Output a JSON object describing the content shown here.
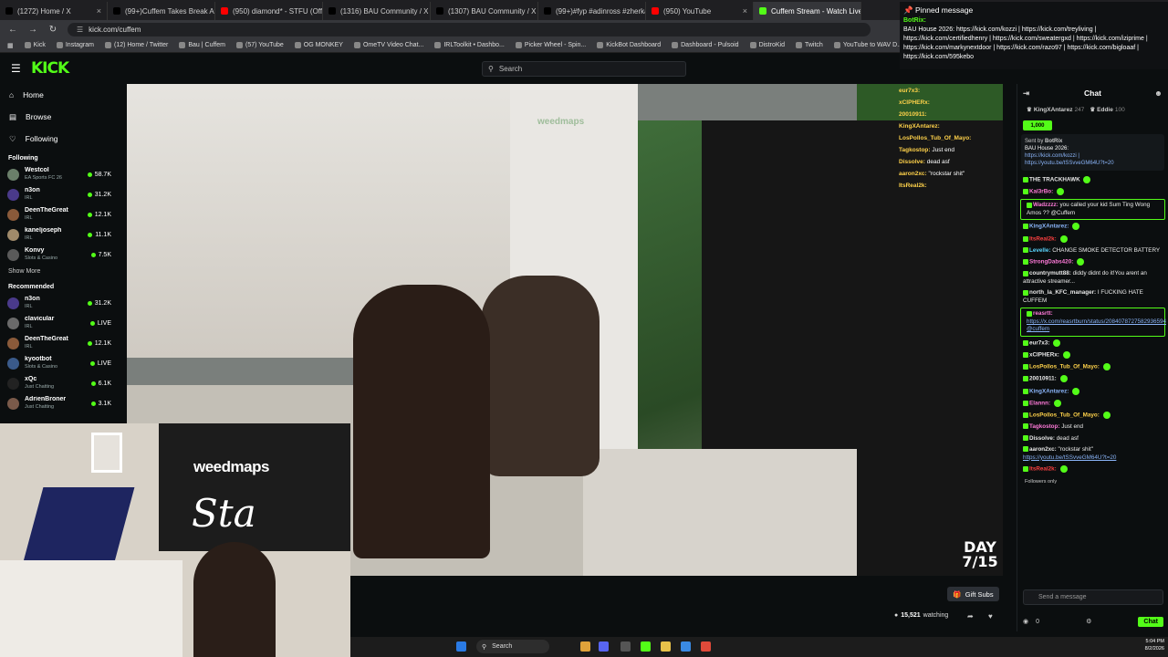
{
  "browser": {
    "tabs": [
      {
        "title": "(1272) Home / X",
        "color": "#000000"
      },
      {
        "title": "(99+)Cuffem Takes Break After",
        "color": "#000000"
      },
      {
        "title": "(950) diamond* - STFU (Official",
        "color": "#ff0000"
      },
      {
        "title": "(1316) BAU Community / X",
        "color": "#000000"
      },
      {
        "title": "(1307) BAU Community / X",
        "color": "#000000"
      },
      {
        "title": "(99+)#fyp #adinross #zherka #",
        "color": "#000000"
      },
      {
        "title": "(950) YouTube",
        "color": "#ff0000"
      },
      {
        "title": "Cuffem Stream - Watch Live on",
        "color": "#53fc18"
      }
    ],
    "url": "kick.com/cuffem",
    "bookmarks": [
      "Kick",
      "Instagram",
      "(12) Home / Twitter",
      "Bau | Cuffem",
      "(57) YouTube",
      "OG MONKEY",
      "OmeTV Video Chat...",
      "IRLToolkit • Dashbo...",
      "Picker Wheel - Spin...",
      "KickBot Dashboard",
      "Dashboard - Pulsoid",
      "DistroKid",
      "Twitch",
      "YouTube to WAV D...",
      "Monkey: Video Chat...",
      "Home - Rob"
    ]
  },
  "header": {
    "logo": "KICK",
    "search_placeholder": "Search"
  },
  "sidebar": {
    "nav": [
      {
        "label": "Home",
        "icon": "home-icon"
      },
      {
        "label": "Browse",
        "icon": "browse-icon"
      },
      {
        "label": "Following",
        "icon": "heart-icon"
      }
    ],
    "following_title": "Following",
    "following": [
      {
        "name": "Westcol",
        "category": "EA Sports FC 26",
        "viewers": "58.7K",
        "color": "#6a7f6a"
      },
      {
        "name": "n3on",
        "category": "IRL",
        "viewers": "31.2K",
        "color": "#4a3a8a"
      },
      {
        "name": "DeenTheGreat",
        "category": "IRL",
        "viewers": "12.1K",
        "color": "#8a5a3a"
      },
      {
        "name": "kaneljoseph",
        "category": "IRL",
        "viewers": "11.1K",
        "color": "#a08a6a"
      },
      {
        "name": "Konvy",
        "category": "Slots & Casino",
        "viewers": "7.5K",
        "color": "#5a5a5a"
      }
    ],
    "show_more": "Show More",
    "recommended_title": "Recommended",
    "recommended": [
      {
        "name": "n3on",
        "category": "IRL",
        "viewers": "31.2K",
        "color": "#4a3a8a"
      },
      {
        "name": "clavicular",
        "category": "IRL",
        "viewers": "LIVE",
        "color": "#6a6a6a"
      },
      {
        "name": "DeenTheGreat",
        "category": "IRL",
        "viewers": "12.1K",
        "color": "#8a5a3a"
      },
      {
        "name": "kyootbot",
        "category": "Slots & Casino",
        "viewers": "LIVE",
        "color": "#3a5a8a"
      },
      {
        "name": "xQc",
        "category": "Just Chatting",
        "viewers": "6.1K",
        "color": "#222222"
      },
      {
        "name": "AdrienBroner",
        "category": "Just Chatting",
        "viewers": "3.1K",
        "color": "#7a5a4a"
      }
    ]
  },
  "video": {
    "day_line1": "DAY",
    "day_line2": "7/15",
    "webcam_banner": "weedmaps",
    "webcam_sign": "Sta",
    "room_brand": "weedmaps",
    "overlay_chat": [
      {
        "user": "eur7x3:",
        "text": ""
      },
      {
        "user": "xCIPHERx:",
        "text": ""
      },
      {
        "user": "20010911:",
        "text": ""
      },
      {
        "user": "KingXAntarez:",
        "text": ""
      },
      {
        "user": "LosPollos_Tub_Of_Mayo:",
        "text": ""
      },
      {
        "user": "Tagkostop:",
        "text": "Just end"
      },
      {
        "user": "Dissolve:",
        "text": "dead asf"
      },
      {
        "user": "aaron2xc:",
        "text": "\"rockstar shit\""
      },
      {
        "user": "ItsReal2k:",
        "text": ""
      }
    ]
  },
  "below_video": {
    "gift_subs": "Gift Subs",
    "watching_count": "15,521",
    "watching_label": "watching"
  },
  "pinned": {
    "title": "Pinned message",
    "author": "BotRix:",
    "text": "BAU House 2026: https://kick.com/kozzi | https://kick.com/treyliving | https://kick.com/certifiedhenry | https://kick.com/sweatergxd | https://kick.com/iziprime | https://kick.com/markynextdoor | https://kick.com/razo97 | https://kick.com/bigloaaf | https://kick.com/595kebo"
  },
  "chat": {
    "title": "Chat",
    "gifters": [
      {
        "name": "KingXAntarez",
        "count": "247"
      },
      {
        "name": "Eddie",
        "count": "100"
      }
    ],
    "goal": "1,000",
    "pin_sent_by": "Sent by",
    "pin_author": "BotRix",
    "pin_text": "BAU House 2026:",
    "pin_link": "https://kick.com/kozzi |",
    "pin_extra": "https://youtu.be/tSSvveGM64U?t=20",
    "messages": [
      {
        "user": "THE TRACKHAWK",
        "text": "",
        "color": "#e8e8e8",
        "hl": false
      },
      {
        "user": "Kal3rBo:",
        "text": "",
        "color": "#ff7ad9",
        "hl": false
      },
      {
        "user": "Wadzzzz:",
        "text": "you called your kid Sum Ting Wong Amos ?? @Cuffem",
        "color": "#ff7ad9",
        "hl": true
      },
      {
        "user": "KingXAntarez:",
        "text": "",
        "color": "#8ab4f8",
        "hl": false
      },
      {
        "user": "ItsReal2k:",
        "text": "",
        "color": "#ff4040",
        "hl": false
      },
      {
        "user": "Levelle:",
        "text": "CHANGE SMOKE DETECTOR BATTERY",
        "color": "#5ad6ff",
        "hl": false
      },
      {
        "user": "StrongDabs420:",
        "text": "",
        "color": "#ff7ad9",
        "hl": false
      },
      {
        "user": "countrymutt88:",
        "text": "diddy didnt do it!You arent an attractive streamer...",
        "color": "#e8e8e8",
        "hl": false
      },
      {
        "user": "north_la_KFC_manager:",
        "text": "I FUCKING HATE CUFFEM",
        "color": "#e8e8e8",
        "hl": false
      },
      {
        "user": "reasrtt:",
        "text": "",
        "color": "#ff7ad9",
        "hl": true,
        "link": "https://x.com/reasrtburn/status/2084078727582936594 @cuffem"
      },
      {
        "user": "eur7x3:",
        "text": "",
        "color": "#e8e8e8",
        "hl": false
      },
      {
        "user": "xCIPHERx:",
        "text": "",
        "color": "#e8e8e8",
        "hl": false
      },
      {
        "user": "LosPollos_Tub_Of_Mayo:",
        "text": "",
        "color": "#ffd24a",
        "hl": false
      },
      {
        "user": "20010911:",
        "text": "",
        "color": "#e8e8e8",
        "hl": false
      },
      {
        "user": "KingXAntarez:",
        "text": "",
        "color": "#8ab4f8",
        "hl": false
      },
      {
        "user": "Elannn:",
        "text": "",
        "color": "#ff7ad9",
        "hl": false
      },
      {
        "user": "LosPollos_Tub_Of_Mayo:",
        "text": "",
        "color": "#ffd24a",
        "hl": false
      },
      {
        "user": "Tagkostop:",
        "text": "Just end",
        "color": "#ff7ad9",
        "hl": false
      },
      {
        "user": "Dissolve:",
        "text": "dead asf",
        "color": "#e8e8e8",
        "hl": false
      },
      {
        "user": "aaron2xc:",
        "text": "\"rockstar shit\"",
        "color": "#e8e8e8",
        "hl": false,
        "link": "https://youtu.be/tSSvveGM64U?t=20"
      },
      {
        "user": "ItsReal2k:",
        "text": "",
        "color": "#ff4040",
        "hl": false
      }
    ],
    "followers_only": "Followers only",
    "input_placeholder": "Send a message",
    "points": "0",
    "chat_button": "Chat"
  },
  "taskbar": {
    "search": "Search",
    "time": "5:04 PM",
    "date": "8/2/2026"
  }
}
